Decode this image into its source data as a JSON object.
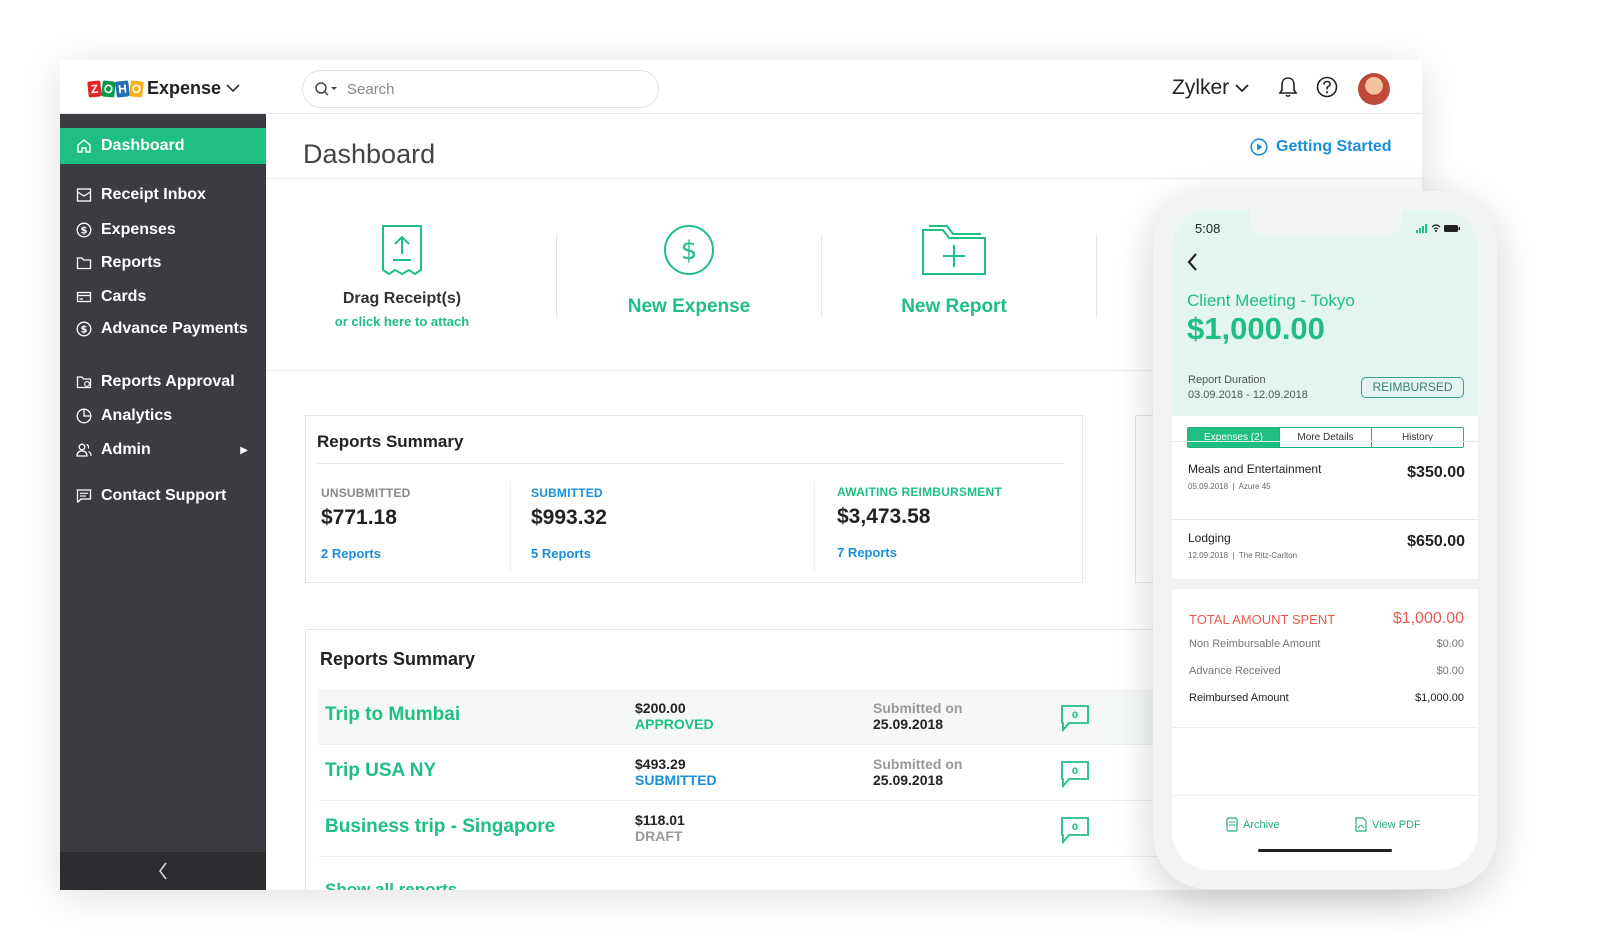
{
  "app": {
    "logo_letters": [
      "Z",
      "O",
      "H",
      "O"
    ],
    "logo_text": "Expense",
    "search_placeholder": "Search",
    "org_name": "Zylker"
  },
  "sidebar": {
    "items": [
      {
        "label": "Dashboard",
        "icon": "home-icon",
        "active": true
      },
      {
        "label": "Receipt Inbox",
        "icon": "inbox-icon"
      },
      {
        "label": "Expenses",
        "icon": "dollar-circle-icon"
      },
      {
        "label": "Reports",
        "icon": "folder-icon"
      },
      {
        "label": "Cards",
        "icon": "card-icon"
      },
      {
        "label": "Advance Payments",
        "icon": "dollar-circle-icon"
      },
      {
        "label": "Reports Approval",
        "icon": "approval-icon"
      },
      {
        "label": "Analytics",
        "icon": "pie-chart-icon"
      },
      {
        "label": "Admin",
        "icon": "users-icon"
      },
      {
        "label": "Contact Support",
        "icon": "chat-icon"
      }
    ]
  },
  "main": {
    "title": "Dashboard",
    "getting_started": "Getting Started",
    "actions": {
      "drag_title": "Drag Receipt(s)",
      "drag_sub": "or click here to attach",
      "new_expense": "New Expense",
      "new_report": "New Report"
    },
    "summary": {
      "title": "Reports Summary",
      "unsubmitted": {
        "label": "UNSUBMITTED",
        "amount": "$771.18",
        "link": "2 Reports"
      },
      "submitted": {
        "label": "SUBMITTED",
        "amount": "$993.32",
        "link": "5 Reports"
      },
      "awaiting": {
        "label": "AWAITING REIMBURSMENT",
        "amount": "$3,473.58",
        "link": "7 Reports"
      }
    },
    "reports": {
      "title": "Reports Summary",
      "rows": [
        {
          "name": "Trip to Mumbai",
          "amount": "$200.00",
          "status": "APPROVED",
          "submitted_label": "Submitted on",
          "date": "25.09.2018",
          "comments": "0"
        },
        {
          "name": "Trip USA NY",
          "amount": "$493.29",
          "status": "SUBMITTED",
          "submitted_label": "Submitted on",
          "date": "25.09.2018",
          "comments": "0"
        },
        {
          "name": "Business trip - Singapore",
          "amount": "$118.01",
          "status": "DRAFT",
          "submitted_label": "",
          "date": "",
          "comments": "0"
        }
      ],
      "show_all": "Show all reports"
    }
  },
  "phone": {
    "time": "5:08",
    "title": "Client Meeting - Tokyo",
    "amount": "$1,000.00",
    "duration_label": "Report Duration",
    "duration": "03.09.2018 - 12.09.2018",
    "badge": "REIMBURSED",
    "tabs": [
      "Expenses (2)",
      "More Details",
      "History"
    ],
    "expenses": [
      {
        "name": "Meals and Entertainment",
        "date": "05.09.2018",
        "merchant": "Azure 45",
        "amount": "$350.00"
      },
      {
        "name": "Lodging",
        "date": "12.09.2018",
        "merchant": "The Ritz-Carlton",
        "amount": "$650.00"
      }
    ],
    "totals": {
      "total_label": "TOTAL AMOUNT SPENT",
      "total": "$1,000.00",
      "non_reimb_label": "Non Reimbursable Amount",
      "non_reimb": "$0.00",
      "advance_label": "Advance Received",
      "advance": "$0.00",
      "reimbursed_label": "Reimbursed Amount",
      "reimbursed": "$1,000.00"
    },
    "footer": {
      "archive": "Archive",
      "view_pdf": "View PDF"
    }
  },
  "colors": {
    "accent": "#1fbf84",
    "link": "#1a8fd9",
    "sidebar": "#3a3c42",
    "alert": "#e85a4f"
  }
}
